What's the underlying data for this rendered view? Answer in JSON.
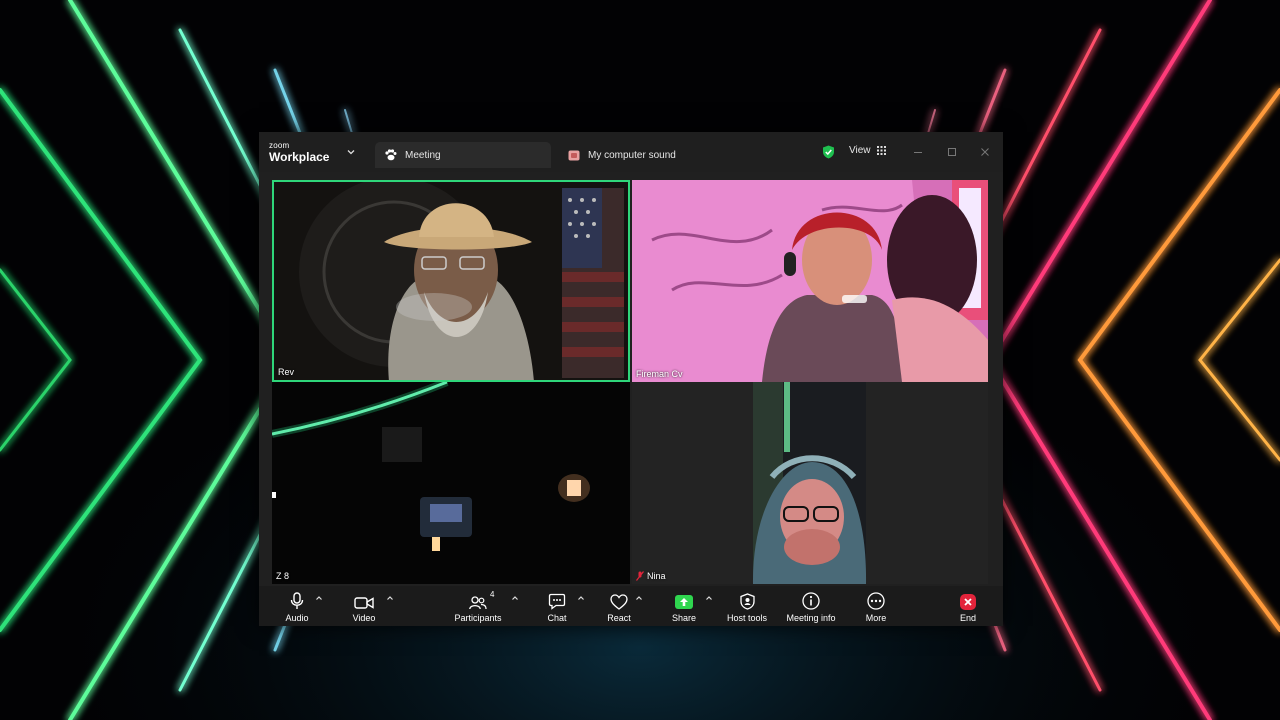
{
  "app": {
    "brand_small": "zoom",
    "brand_name": "Workplace"
  },
  "tabs": [
    {
      "label": "Meeting",
      "icon": "paw-icon"
    },
    {
      "label": "My computer sound",
      "icon": "sound-share-icon"
    }
  ],
  "header": {
    "view_label": "View",
    "security_color": "#1fbf4f"
  },
  "participants": [
    {
      "name": "Rev",
      "active_speaker": true,
      "muted": false
    },
    {
      "name": "Fireman Cv",
      "active_speaker": false,
      "muted": false
    },
    {
      "name": "Z 8",
      "active_speaker": false,
      "muted": false
    },
    {
      "name": "Nina",
      "active_speaker": false,
      "muted": true
    }
  ],
  "toolbar": {
    "audio": "Audio",
    "video": "Video",
    "participants": "Participants",
    "participants_count": "4",
    "chat": "Chat",
    "react": "React",
    "share": "Share",
    "host_tools": "Host tools",
    "meeting_info": "Meeting info",
    "more": "More",
    "end": "End"
  },
  "colors": {
    "speaker_border": "#2fd67a",
    "share_green": "#2fd64f",
    "end_red": "#e3243b"
  }
}
